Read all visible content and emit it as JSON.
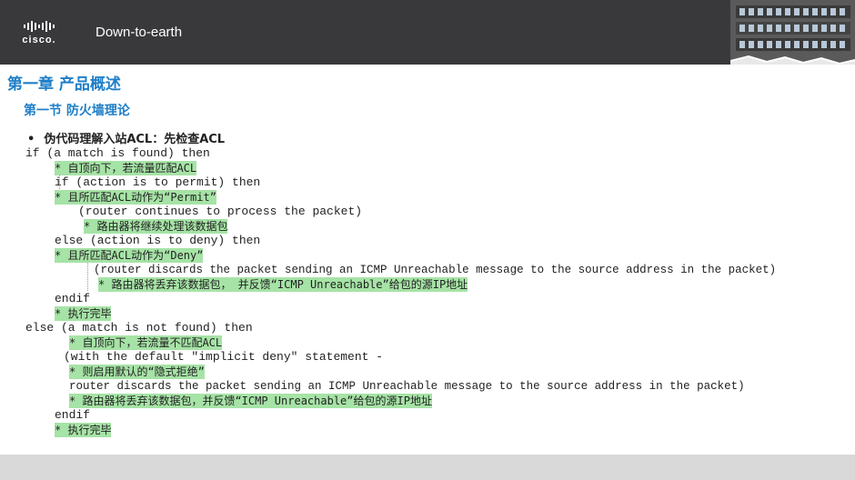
{
  "header": {
    "logo_text": "cisco.",
    "title": "Down-to-earth"
  },
  "heading": {
    "chapter": "第一章 产品概述",
    "section": "第一节 防火墙理论"
  },
  "bullet": {
    "marker": "•",
    "text": "伪代码理解入站ACL：先检查ACL"
  },
  "code_lines": [
    {
      "text": "if (a match is found) then",
      "highlight": false
    },
    {
      "text": "* 自顶向下，若流量匹配ACL",
      "highlight": true
    },
    {
      "text": "if (action is to permit) then",
      "highlight": false
    },
    {
      "text": "* 且所匹配ACL动作为“Permit”",
      "highlight": true
    },
    {
      "text": "(router continues to process the packet)",
      "highlight": false
    },
    {
      "text": "* 路由器将继续处理该数据包",
      "highlight": true
    },
    {
      "text": "else (action is to deny) then",
      "highlight": false
    },
    {
      "text": "* 且所匹配ACL动作为“Deny”",
      "highlight": true
    },
    {
      "text": "(router discards the packet sending an ICMP Unreachable message to the source address in the packet)",
      "highlight": false
    },
    {
      "text": "* 路由器将丢弃该数据包， 并反馈“ICMP Unreachable”给包的源IP地址",
      "highlight": true
    },
    {
      "text": "endif",
      "highlight": false
    },
    {
      "text": "* 执行完毕",
      "highlight": true
    },
    {
      "text": "else (a match is not found) then",
      "highlight": false
    },
    {
      "text": "* 自顶向下，若流量不匹配ACL",
      "highlight": true
    },
    {
      "text": "(with the default \"implicit deny\" statement -",
      "highlight": false
    },
    {
      "text": "* 则启用默认的“隐式拒绝”",
      "highlight": true
    },
    {
      "text": "router discards the packet sending an ICMP Unreachable message to the source address in the packet)",
      "highlight": false
    },
    {
      "text": "* 路由器将丢弃该数据包，并反馈“ICMP Unreachable”给包的源IP地址",
      "highlight": true
    },
    {
      "text": "endif",
      "highlight": false
    },
    {
      "text": "* 执行完毕",
      "highlight": true
    }
  ]
}
